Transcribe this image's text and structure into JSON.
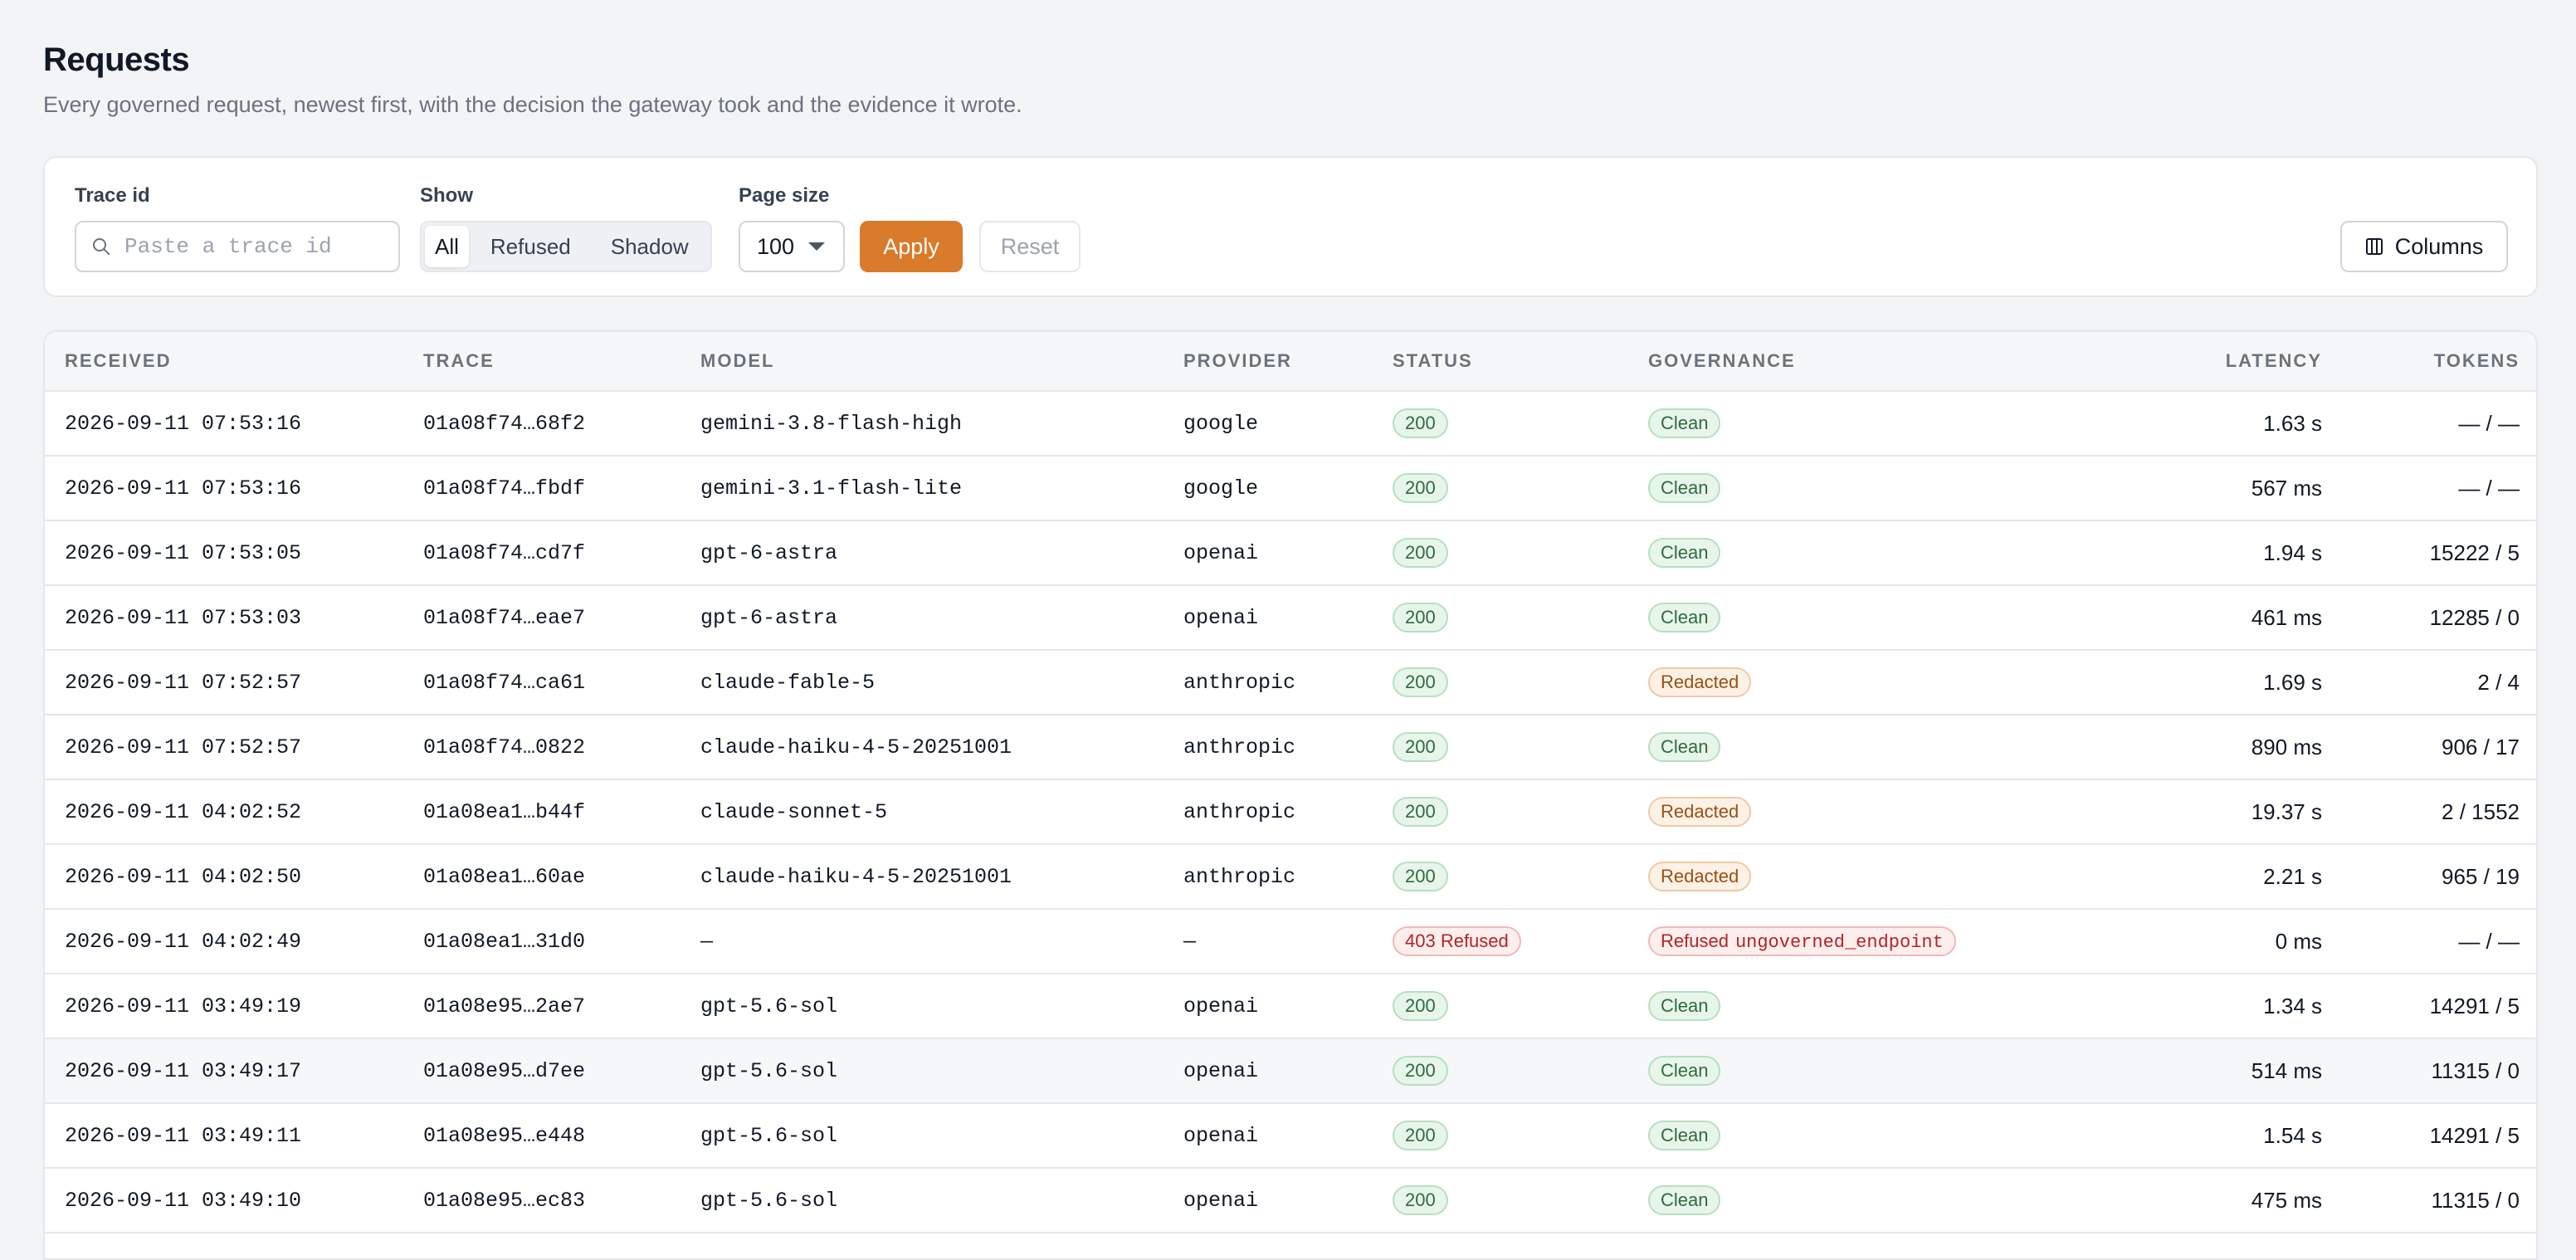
{
  "header": {
    "title": "Requests",
    "subtitle": "Every governed request, newest first, with the decision the gateway took and the evidence it wrote."
  },
  "filters": {
    "trace_label": "Trace id",
    "trace_placeholder": "Paste a trace id",
    "trace_value": "",
    "show_label": "Show",
    "show_options": [
      "All",
      "Refused",
      "Shadow"
    ],
    "show_selected": "All",
    "page_size_label": "Page size",
    "page_size_value": "100",
    "apply_label": "Apply",
    "reset_label": "Reset",
    "columns_label": "Columns"
  },
  "colors": {
    "accent": "#d97b2a",
    "ok": "#2f6b3f",
    "refused": "#b42323",
    "redacted": "#9a4f12"
  },
  "table": {
    "columns": [
      "RECEIVED",
      "TRACE",
      "MODEL",
      "PROVIDER",
      "STATUS",
      "GOVERNANCE",
      "LATENCY",
      "TOKENS"
    ],
    "rows": [
      {
        "received": "2026-09-11 07:53:16",
        "trace": "01a08f74…68f2",
        "model": "gemini-3.8-flash-high",
        "provider": "google",
        "status": "200",
        "status_kind": "ok",
        "governance": "Clean",
        "gov_kind": "ok",
        "gov_reason": "",
        "latency": "1.63 s",
        "tokens": "— / —"
      },
      {
        "received": "2026-09-11 07:53:16",
        "trace": "01a08f74…fbdf",
        "model": "gemini-3.1-flash-lite",
        "provider": "google",
        "status": "200",
        "status_kind": "ok",
        "governance": "Clean",
        "gov_kind": "ok",
        "gov_reason": "",
        "latency": "567 ms",
        "tokens": "— / —"
      },
      {
        "received": "2026-09-11 07:53:05",
        "trace": "01a08f74…cd7f",
        "model": "gpt-6-astra",
        "provider": "openai",
        "status": "200",
        "status_kind": "ok",
        "governance": "Clean",
        "gov_kind": "ok",
        "gov_reason": "",
        "latency": "1.94 s",
        "tokens": "15222 / 5"
      },
      {
        "received": "2026-09-11 07:53:03",
        "trace": "01a08f74…eae7",
        "model": "gpt-6-astra",
        "provider": "openai",
        "status": "200",
        "status_kind": "ok",
        "governance": "Clean",
        "gov_kind": "ok",
        "gov_reason": "",
        "latency": "461 ms",
        "tokens": "12285 / 0"
      },
      {
        "received": "2026-09-11 07:52:57",
        "trace": "01a08f74…ca61",
        "model": "claude-fable-5",
        "provider": "anthropic",
        "status": "200",
        "status_kind": "ok",
        "governance": "Redacted",
        "gov_kind": "amber",
        "gov_reason": "",
        "latency": "1.69 s",
        "tokens": "2 / 4"
      },
      {
        "received": "2026-09-11 07:52:57",
        "trace": "01a08f74…0822",
        "model": "claude-haiku-4-5-20251001",
        "provider": "anthropic",
        "status": "200",
        "status_kind": "ok",
        "governance": "Clean",
        "gov_kind": "ok",
        "gov_reason": "",
        "latency": "890 ms",
        "tokens": "906 / 17"
      },
      {
        "received": "2026-09-11 04:02:52",
        "trace": "01a08ea1…b44f",
        "model": "claude-sonnet-5",
        "provider": "anthropic",
        "status": "200",
        "status_kind": "ok",
        "governance": "Redacted",
        "gov_kind": "amber",
        "gov_reason": "",
        "latency": "19.37 s",
        "tokens": "2 / 1552"
      },
      {
        "received": "2026-09-11 04:02:50",
        "trace": "01a08ea1…60ae",
        "model": "claude-haiku-4-5-20251001",
        "provider": "anthropic",
        "status": "200",
        "status_kind": "ok",
        "governance": "Redacted",
        "gov_kind": "amber",
        "gov_reason": "",
        "latency": "2.21 s",
        "tokens": "965 / 19"
      },
      {
        "received": "2026-09-11 04:02:49",
        "trace": "01a08ea1…31d0",
        "model": "—",
        "provider": "—",
        "status": "403 Refused",
        "status_kind": "red",
        "governance": "Refused",
        "gov_kind": "red",
        "gov_reason": "ungoverned_endpoint",
        "latency": "0 ms",
        "tokens": "— / —"
      },
      {
        "received": "2026-09-11 03:49:19",
        "trace": "01a08e95…2ae7",
        "model": "gpt-5.6-sol",
        "provider": "openai",
        "status": "200",
        "status_kind": "ok",
        "governance": "Clean",
        "gov_kind": "ok",
        "gov_reason": "",
        "latency": "1.34 s",
        "tokens": "14291 / 5"
      },
      {
        "received": "2026-09-11 03:49:17",
        "trace": "01a08e95…d7ee",
        "model": "gpt-5.6-sol",
        "provider": "openai",
        "status": "200",
        "status_kind": "ok",
        "governance": "Clean",
        "gov_kind": "ok",
        "gov_reason": "",
        "latency": "514 ms",
        "tokens": "11315 / 0"
      },
      {
        "received": "2026-09-11 03:49:11",
        "trace": "01a08e95…e448",
        "model": "gpt-5.6-sol",
        "provider": "openai",
        "status": "200",
        "status_kind": "ok",
        "governance": "Clean",
        "gov_kind": "ok",
        "gov_reason": "",
        "latency": "1.54 s",
        "tokens": "14291 / 5"
      },
      {
        "received": "2026-09-11 03:49:10",
        "trace": "01a08e95…ec83",
        "model": "gpt-5.6-sol",
        "provider": "openai",
        "status": "200",
        "status_kind": "ok",
        "governance": "Clean",
        "gov_kind": "ok",
        "gov_reason": "",
        "latency": "475 ms",
        "tokens": "11315 / 0"
      }
    ]
  }
}
